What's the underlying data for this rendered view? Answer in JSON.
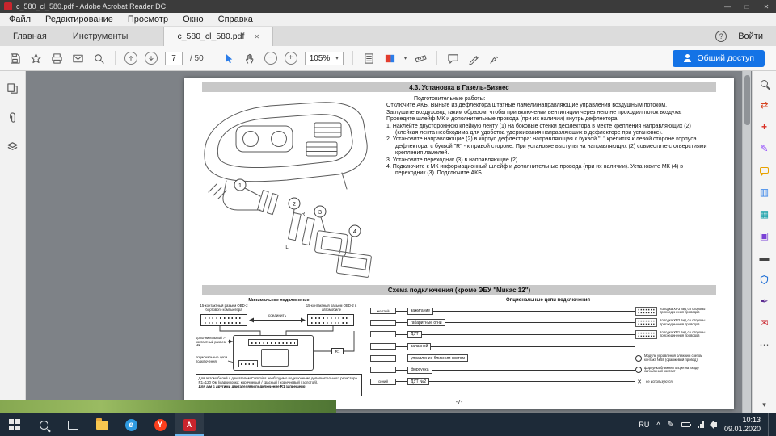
{
  "window": {
    "title": "c_580_cl_580.pdf - Adobe Acrobat Reader DC",
    "controls": {
      "minimize": "—",
      "maximize": "□",
      "close": "✕"
    }
  },
  "glyphs": {
    "cross": "✕",
    "caret": "▾"
  },
  "menubar": {
    "items": [
      "Файл",
      "Редактирование",
      "Просмотр",
      "Окно",
      "Справка"
    ]
  },
  "tabbar": {
    "home": "Главная",
    "tools": "Инструменты",
    "document_tab": "c_580_cl_580.pdf",
    "tab_close": "✕",
    "help": "?",
    "signin": "Войти"
  },
  "toolbar": {
    "page_current": "7",
    "page_total": "/ 50",
    "zoom_value": "105%",
    "zoom_out": "−",
    "zoom_in": "+",
    "share_label": "Общий доступ"
  },
  "tools_rail": {
    "chevron": "▾",
    "icons": [
      {
        "name": "search-tools-icon",
        "glyph": "",
        "color": "#5a5a5a"
      },
      {
        "name": "export-pdf-icon",
        "glyph": "⇄",
        "color": "#d6431f"
      },
      {
        "name": "create-pdf-icon",
        "glyph": "+",
        "color": "#d93025"
      },
      {
        "name": "edit-pdf-icon",
        "glyph": "✎",
        "color": "#8a3ffc"
      },
      {
        "name": "comment-icon",
        "glyph": "",
        "color": "#e8a200"
      },
      {
        "name": "combine-files-icon",
        "glyph": "▥",
        "color": "#2b7de9"
      },
      {
        "name": "organize-pages-icon",
        "glyph": "▦",
        "color": "#13a0a8"
      },
      {
        "name": "compress-pdf-icon",
        "glyph": "▣",
        "color": "#7a42d6"
      },
      {
        "name": "redact-icon",
        "glyph": "▬",
        "color": "#444444"
      },
      {
        "name": "protect-icon",
        "glyph": "",
        "color": "#1f6fd6"
      },
      {
        "name": "fill-sign-icon",
        "glyph": "✒",
        "color": "#5c2d91"
      },
      {
        "name": "send-signature-icon",
        "glyph": "✉",
        "color": "#c9252d"
      },
      {
        "name": "more-tools-icon",
        "glyph": "⋯",
        "color": "#555555"
      }
    ]
  },
  "document": {
    "section1_title": "4.3. Установка в Газель-Бизнес",
    "prep": {
      "title": "Подготовительные работы:",
      "paragraphs": [
        "Отключите АКБ. Выньте из дефлектора штатные ламели/направляющие управления воздушным потоком.",
        "Заглушите воздуховод таким образом, чтобы при включении вентиляции через него не проходил поток воздуха.",
        "Проведите шлейф МК и дополнительные провода (при их наличии) внутрь дефлектора."
      ],
      "steps": [
        "1. Наклейте двустороннюю клейкую ленту (1) на боковые стенки дефлектора в месте крепления направляющих (2) (клейкая лента необходима для удобства удерживания направляющих в дефлекторе при установке).",
        "2. Установите направляющие (2) в корпус дефлектора: направляющая с буквой \"L\" крепится к левой стороне корпуса дефлектора, с буквой \"R\" - к правой стороне. При установке выступы на направляющих (2) совместите с отверстиями крепления ламелей.",
        "3. Установите переходник (3) в направляющие (2).",
        "4. Подключите к МК информационный шлейф и дополнительные провода (при их наличии). Установите МК (4) в переходник (3). Подключите АКБ."
      ]
    },
    "drawing": {
      "callouts": [
        "1",
        "2",
        "3",
        "4"
      ],
      "guide_letters": {
        "right": "R",
        "left": "L"
      }
    },
    "schema": {
      "title": "Схема подключения (кроме ЭБУ \"Микас 12\")",
      "min": {
        "title": "Минимальное подключение",
        "left_label": "15-контактный разъем OBD-2 бортового компьютера",
        "right_label": "15-контактный разъем OBD-2 в автомобиле",
        "connect": "соединить",
        "mk_label": "дополнительный 7-контактный разъем МК",
        "optional_label": "опциональные цепи подключения",
        "r1": "R1",
        "note1": "Для автомобилей с двигателем Cummins необходимо подключение дополнительного резистора R1=120 Ом (маркировка: коричневый / красный / коричневый / золотой).",
        "note2": "Для а/м с другими двигателями подключение R1 запрещено!"
      },
      "optional": {
        "title": "Опциональные цепи подключения",
        "rows": [
          {
            "wire": "желтый",
            "label": "зажигание",
            "ann": "Колодка XP3 вид со стороны присоединения проводов"
          },
          {
            "wire": "",
            "label": "габаритные огни",
            "ann": "Колодка XP2 вид со стороны присоединения проводов"
          },
          {
            "wire": "",
            "label": "ДУТ",
            "ann": "Колодка XP1 вид со стороны присоединения проводов"
          },
          {
            "wire": "",
            "label": "запасной",
            "ann": ""
          },
          {
            "wire": "",
            "label": "управление ближним светом",
            "ann": "Модуль управления ближним светом контакт №58 (оранжевый провод)"
          },
          {
            "wire": "",
            "label": "форсунка",
            "ann": "форсунка ближняя опция на входе сигнальный контакт"
          },
          {
            "wire": "синий",
            "label": "ДУТ №2",
            "ann": "не используются"
          }
        ]
      }
    },
    "page_number": "-7-"
  },
  "taskbar": {
    "apps": [
      {
        "name": "file-explorer",
        "letter": ""
      },
      {
        "name": "edge-browser",
        "letter": "e"
      },
      {
        "name": "yandex-browser",
        "letter": "Y"
      },
      {
        "name": "acrobat-reader",
        "letter": "A"
      }
    ],
    "tray": {
      "lang": "RU",
      "chevron": "^",
      "pen": "✎",
      "time": "10:13",
      "date": "09.01.2020"
    }
  }
}
